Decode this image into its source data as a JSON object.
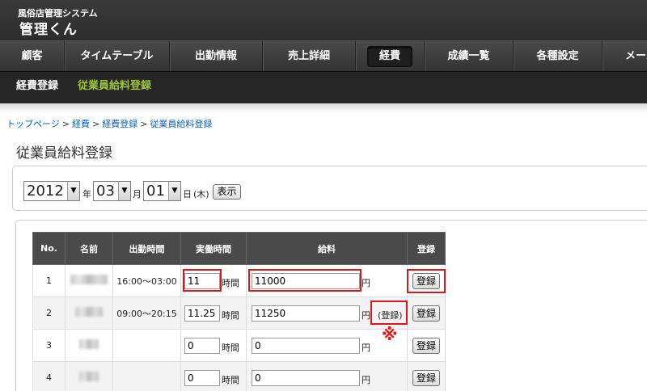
{
  "app": {
    "subtitle": "風俗店管理システム",
    "title": "管理くん"
  },
  "nav": {
    "items": [
      {
        "label": "顧客"
      },
      {
        "label": "タイムテーブル"
      },
      {
        "label": "出勤情報"
      },
      {
        "label": "売上詳細"
      },
      {
        "label": "経費"
      },
      {
        "label": "成績一覧"
      },
      {
        "label": "各種設定"
      },
      {
        "label": "メール"
      }
    ],
    "active_index": 4
  },
  "subnav": {
    "items": [
      {
        "label": "経費登録"
      },
      {
        "label": "従業員給料登録"
      }
    ],
    "current_index": 1
  },
  "breadcrumb": {
    "items": [
      "トップページ",
      "経費",
      "経費登録",
      "従業員給料登録"
    ],
    "separator": ">"
  },
  "page_title": "従業員給料登録",
  "date": {
    "year": "2012",
    "year_unit": "年",
    "month": "03",
    "month_unit": "月",
    "day": "01",
    "day_unit": "日",
    "weekday": "(木)",
    "show_button": "表示"
  },
  "table": {
    "headers": [
      "No.",
      "名前",
      "出勤時間",
      "実働時間",
      "給料",
      "登録"
    ],
    "rows": [
      {
        "no": "1",
        "shift": "16:00〜03:00",
        "hours": "11",
        "hours_unit": "時間",
        "salary": "11000",
        "salary_unit": "円",
        "register": "登録"
      },
      {
        "no": "2",
        "shift": "09:00〜20:15",
        "hours": "11.25",
        "hours_unit": "時間",
        "salary": "11250",
        "salary_unit": "円",
        "register": "登録",
        "registered_label": "(登録)"
      },
      {
        "no": "3",
        "shift": "",
        "hours": "0",
        "hours_unit": "時間",
        "salary": "0",
        "salary_unit": "円",
        "register": "登録"
      },
      {
        "no": "4",
        "shift": "",
        "hours": "0",
        "hours_unit": "時間",
        "salary": "0",
        "salary_unit": "円",
        "register": "登録"
      }
    ]
  },
  "annotation_mark": "※",
  "colors": {
    "highlight": "#d7191f",
    "subnav_current": "#9dc43a",
    "link": "#0a63b0"
  }
}
